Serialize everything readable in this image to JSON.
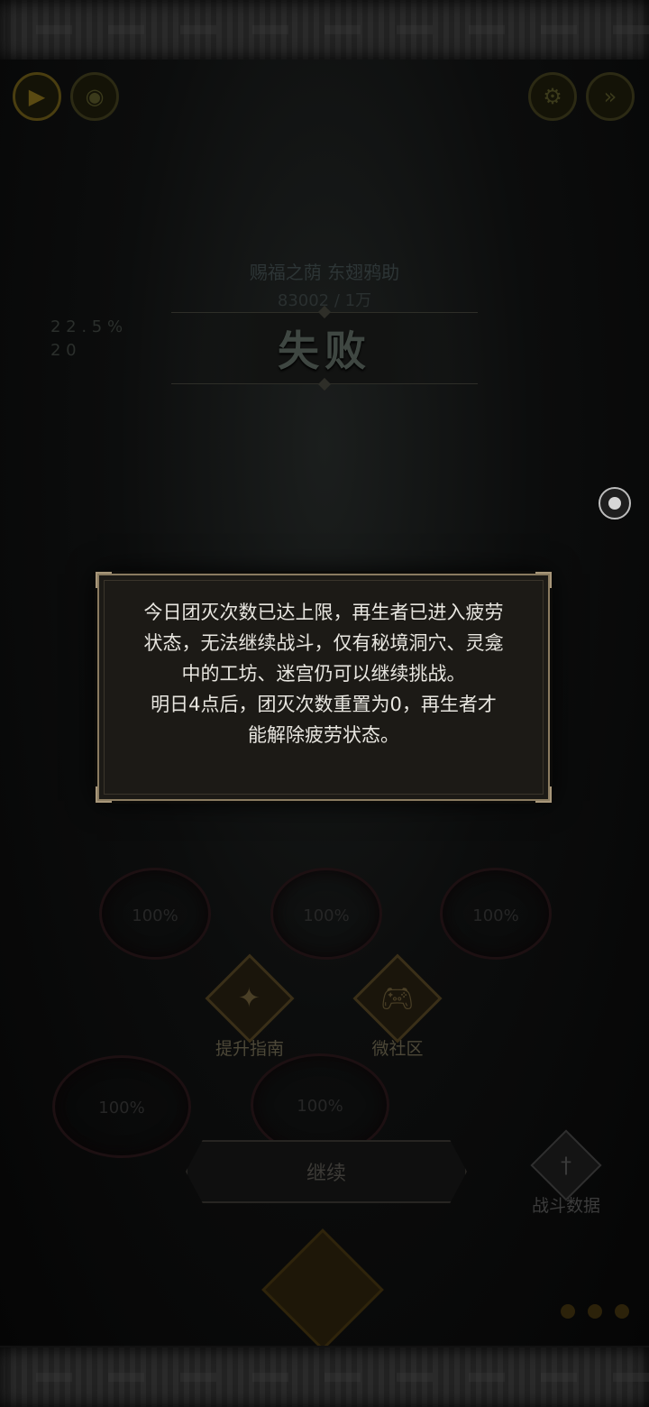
{
  "result": {
    "title": "失败"
  },
  "enemy": {
    "name": "赐福之荫 东翅鸦助",
    "hp": "83002 / 1万"
  },
  "stats": [
    "2 2 . 5 %",
    "2 0"
  ],
  "dialog": {
    "lines": [
      "今日团灭次数已达上限，再生者已进入疲劳状态，无法继续战斗，仅有秘境洞穴、灵龛中的工坊、迷宫仍可以继续挑战。",
      "明日4点后，团灭次数重置为0，再生者才能解除疲劳状态。"
    ]
  },
  "party": {
    "hp_labels": [
      "100%",
      "100%",
      "100%",
      "100%",
      "100%"
    ]
  },
  "features": {
    "guide_label": "提升指南",
    "community_label": "微社区"
  },
  "actions": {
    "continue_label": "继续",
    "battle_data_label": "战斗数据"
  },
  "icons": {
    "hud": [
      "play-icon",
      "record-icon",
      "settings-icon",
      "speed-icon"
    ],
    "guide": "compass-icon",
    "community": "gamepad-icon",
    "battle_data": "sword-icon",
    "float": "assistive-touch-icon"
  },
  "colors": {
    "dialog_border": "#8a7b60",
    "dialog_bg": "#1c1a16",
    "dialog_text": "#e8e6e0"
  }
}
